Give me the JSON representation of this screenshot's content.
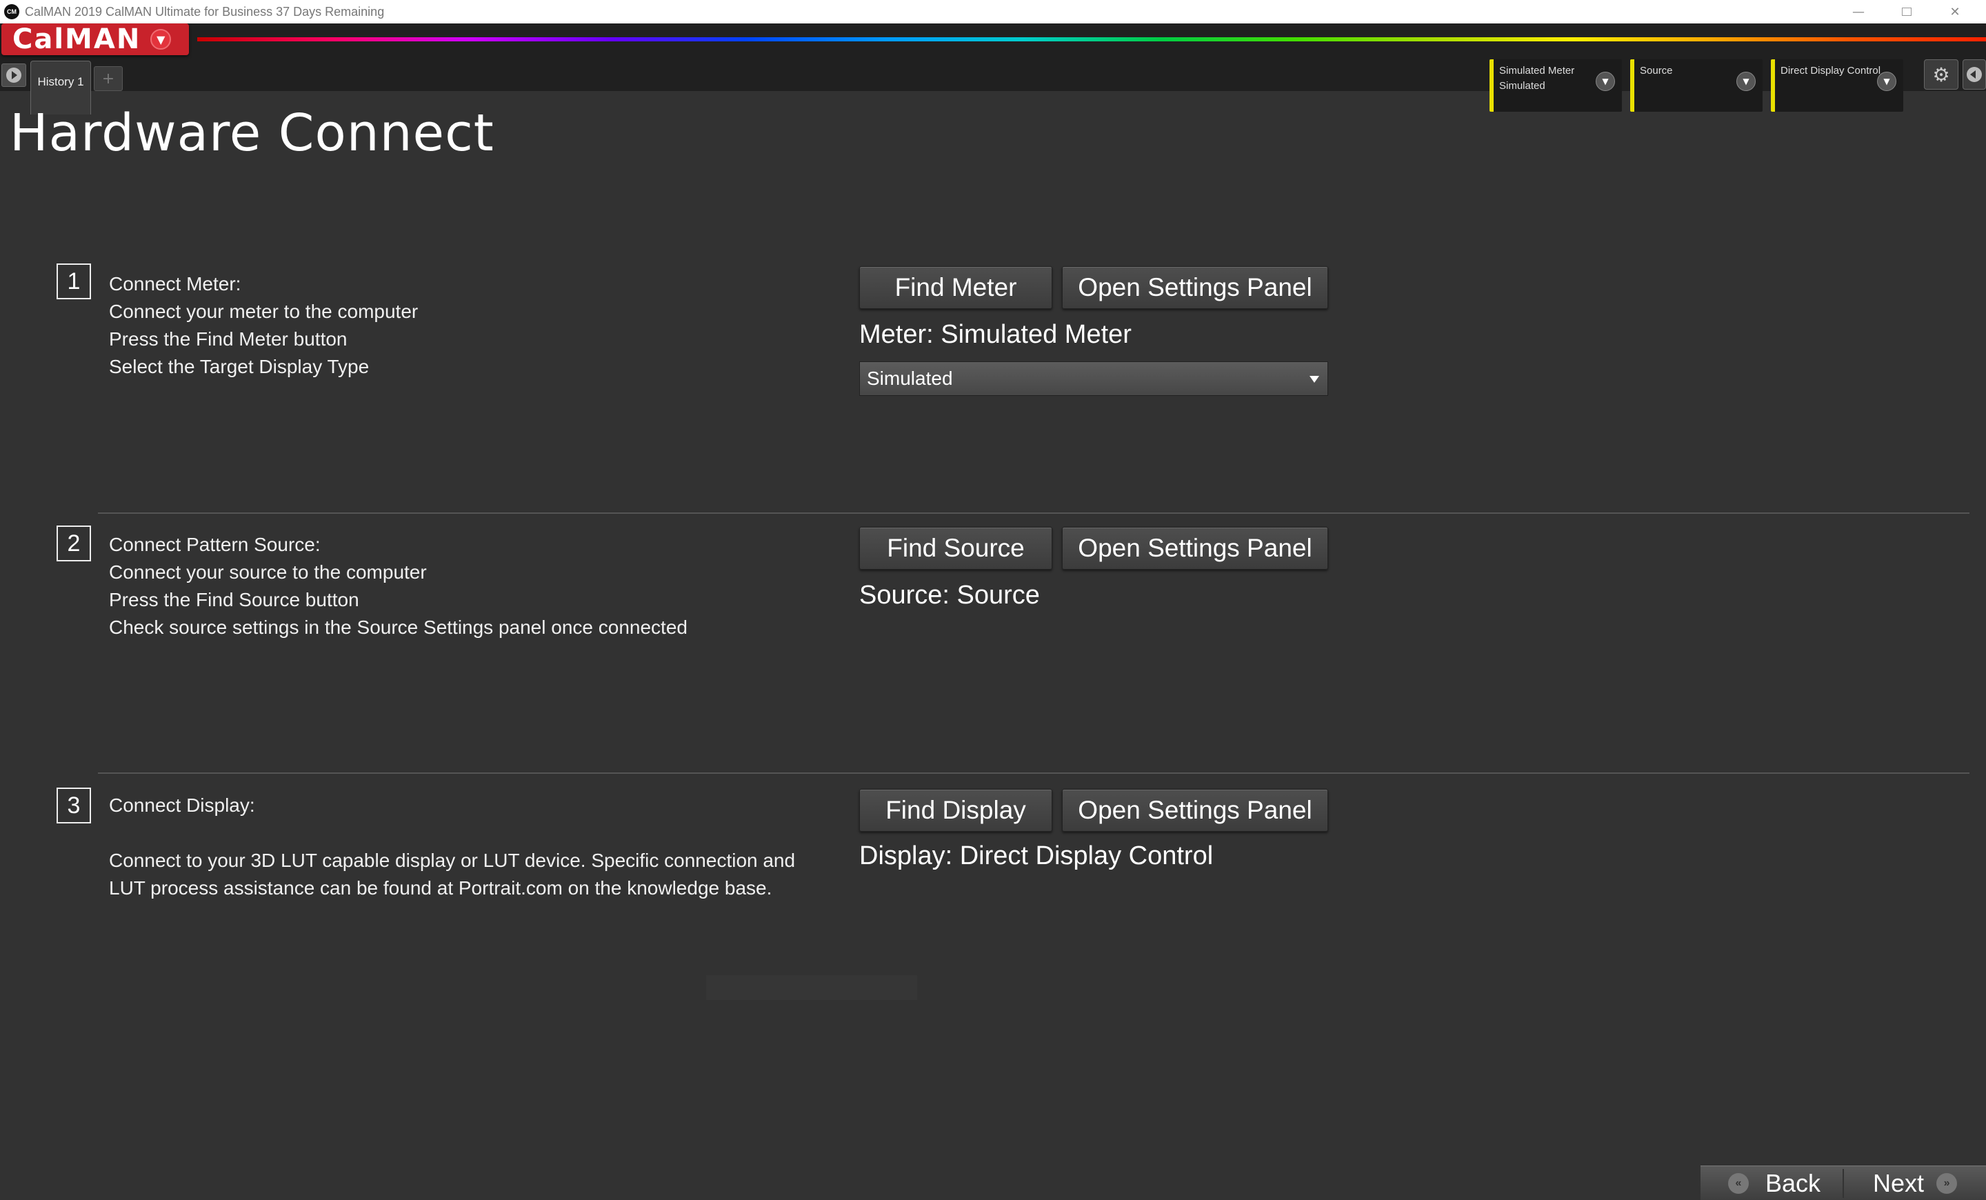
{
  "window": {
    "title": "CalMAN 2019 CalMAN Ultimate for Business 37 Days Remaining",
    "app_icon": "CM"
  },
  "app": {
    "logo": "CalMAN",
    "history_tab": "History 1",
    "add_tab": "+"
  },
  "devices": {
    "meter": {
      "line1": "Simulated Meter",
      "line2": "Simulated"
    },
    "source": {
      "line1": "Source",
      "line2": ""
    },
    "display": {
      "line1": "Direct Display Control",
      "line2": ""
    }
  },
  "page": {
    "title": "Hardware Connect"
  },
  "steps": [
    {
      "number": "1",
      "lines": [
        "Connect Meter:",
        "Connect your meter to the computer",
        "Press the Find Meter button",
        "Select the Target Display Type"
      ],
      "find_button": "Find Meter",
      "settings_button": "Open Settings Panel",
      "status": "Meter: Simulated Meter",
      "select_value": "Simulated"
    },
    {
      "number": "2",
      "lines": [
        "Connect Pattern Source:",
        "Connect your source to the computer",
        "Press the Find Source button",
        "Check source settings in the Source Settings panel once connected"
      ],
      "find_button": "Find Source",
      "settings_button": "Open Settings Panel",
      "status": "Source: Source"
    },
    {
      "number": "3",
      "lines": [
        "Connect Display:",
        "",
        "Connect to your 3D LUT capable display or LUT device.  Specific connection and",
        "LUT process assistance can be found at Portrait.com on the knowledge base."
      ],
      "find_button": "Find Display",
      "settings_button": "Open Settings Panel",
      "status": "Display: Direct Display Control"
    }
  ],
  "nav": {
    "back": "Back",
    "next": "Next"
  },
  "colors": {
    "background": "#323232",
    "accent_red": "#c8222b",
    "device_marker": "#e9e000"
  }
}
